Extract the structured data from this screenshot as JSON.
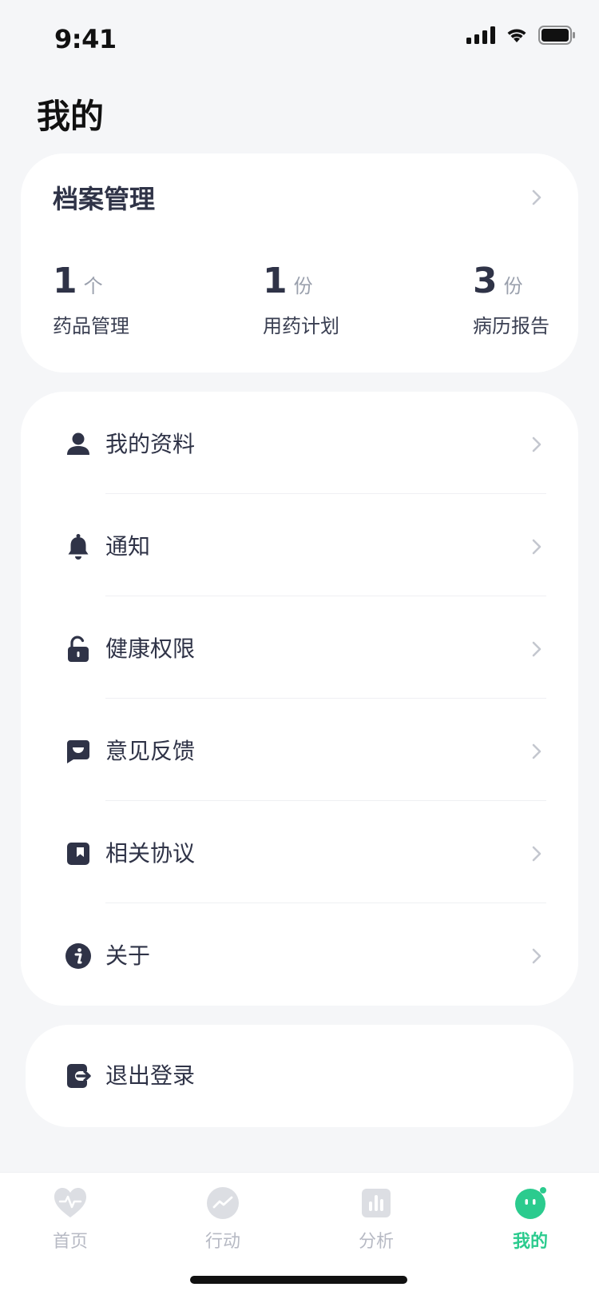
{
  "status_bar": {
    "time": "9:41"
  },
  "page_title": "我的",
  "profile_card": {
    "title": "档案管理",
    "stats": [
      {
        "value": "1",
        "unit": "个",
        "label": "药品管理"
      },
      {
        "value": "1",
        "unit": "份",
        "label": "用药计划"
      },
      {
        "value": "3",
        "unit": "份",
        "label": "病历报告"
      }
    ]
  },
  "menu": [
    {
      "label": "我的资料",
      "icon": "person-icon"
    },
    {
      "label": "通知",
      "icon": "bell-icon"
    },
    {
      "label": "健康权限",
      "icon": "unlock-icon"
    },
    {
      "label": "意见反馈",
      "icon": "feedback-icon"
    },
    {
      "label": "相关协议",
      "icon": "bookmark-icon"
    },
    {
      "label": "关于",
      "icon": "info-icon"
    }
  ],
  "logout": {
    "label": "退出登录",
    "icon": "logout-icon"
  },
  "tabs": [
    {
      "label": "首页",
      "icon": "heart-pulse-icon",
      "active": false
    },
    {
      "label": "行动",
      "icon": "trend-icon",
      "active": false
    },
    {
      "label": "分析",
      "icon": "bar-chart-icon",
      "active": false
    },
    {
      "label": "我的",
      "icon": "face-icon",
      "active": true
    }
  ],
  "colors": {
    "accent": "#2BCB8E",
    "text": "#2F3347",
    "muted": "#9AA0AD",
    "background": "#F5F6F8"
  }
}
